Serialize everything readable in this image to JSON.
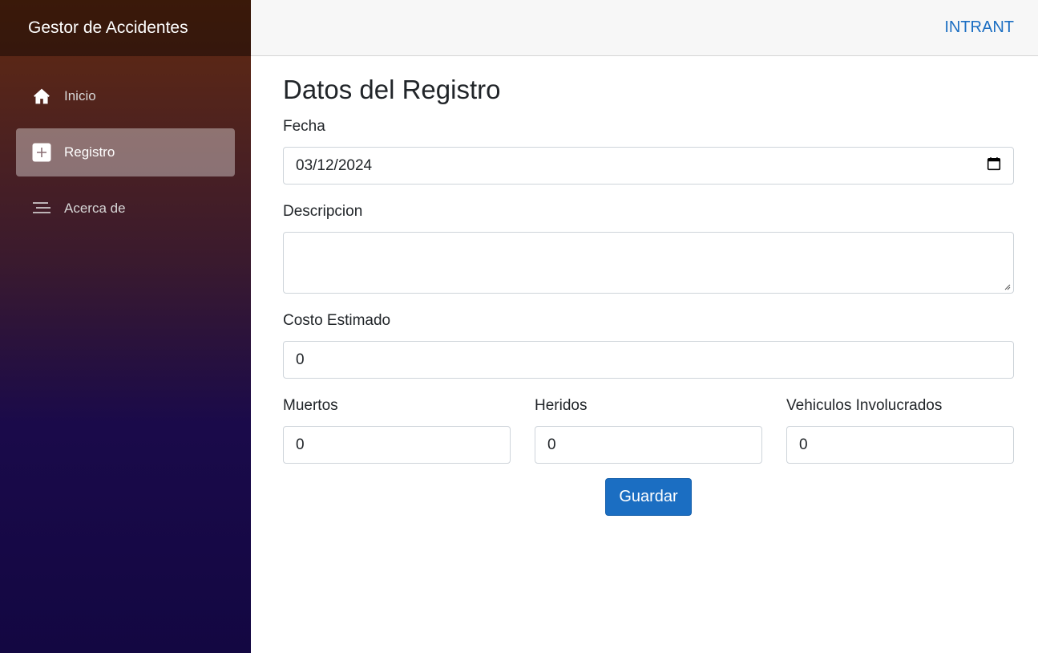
{
  "sidebar": {
    "brand": "Gestor de Accidentes",
    "items": [
      {
        "label": "Inicio",
        "icon": "house-icon",
        "active": false
      },
      {
        "label": "Registro",
        "icon": "plus-square-icon",
        "active": true
      },
      {
        "label": "Acerca de",
        "icon": "list-icon",
        "active": false
      }
    ]
  },
  "topbar": {
    "link": "INTRANT"
  },
  "form": {
    "title": "Datos del Registro",
    "fecha": {
      "label": "Fecha",
      "value": "03/12/2024"
    },
    "descripcion": {
      "label": "Descripcion",
      "value": ""
    },
    "costo": {
      "label": "Costo Estimado",
      "value": "0"
    },
    "muertos": {
      "label": "Muertos",
      "value": "0"
    },
    "heridos": {
      "label": "Heridos",
      "value": "0"
    },
    "vehiculos": {
      "label": "Vehiculos Involucrados",
      "value": "0"
    },
    "submit_label": "Guardar"
  },
  "colors": {
    "accent": "#1b6ec2",
    "sidebar_top": "#622a10",
    "sidebar_bottom": "#130742"
  }
}
